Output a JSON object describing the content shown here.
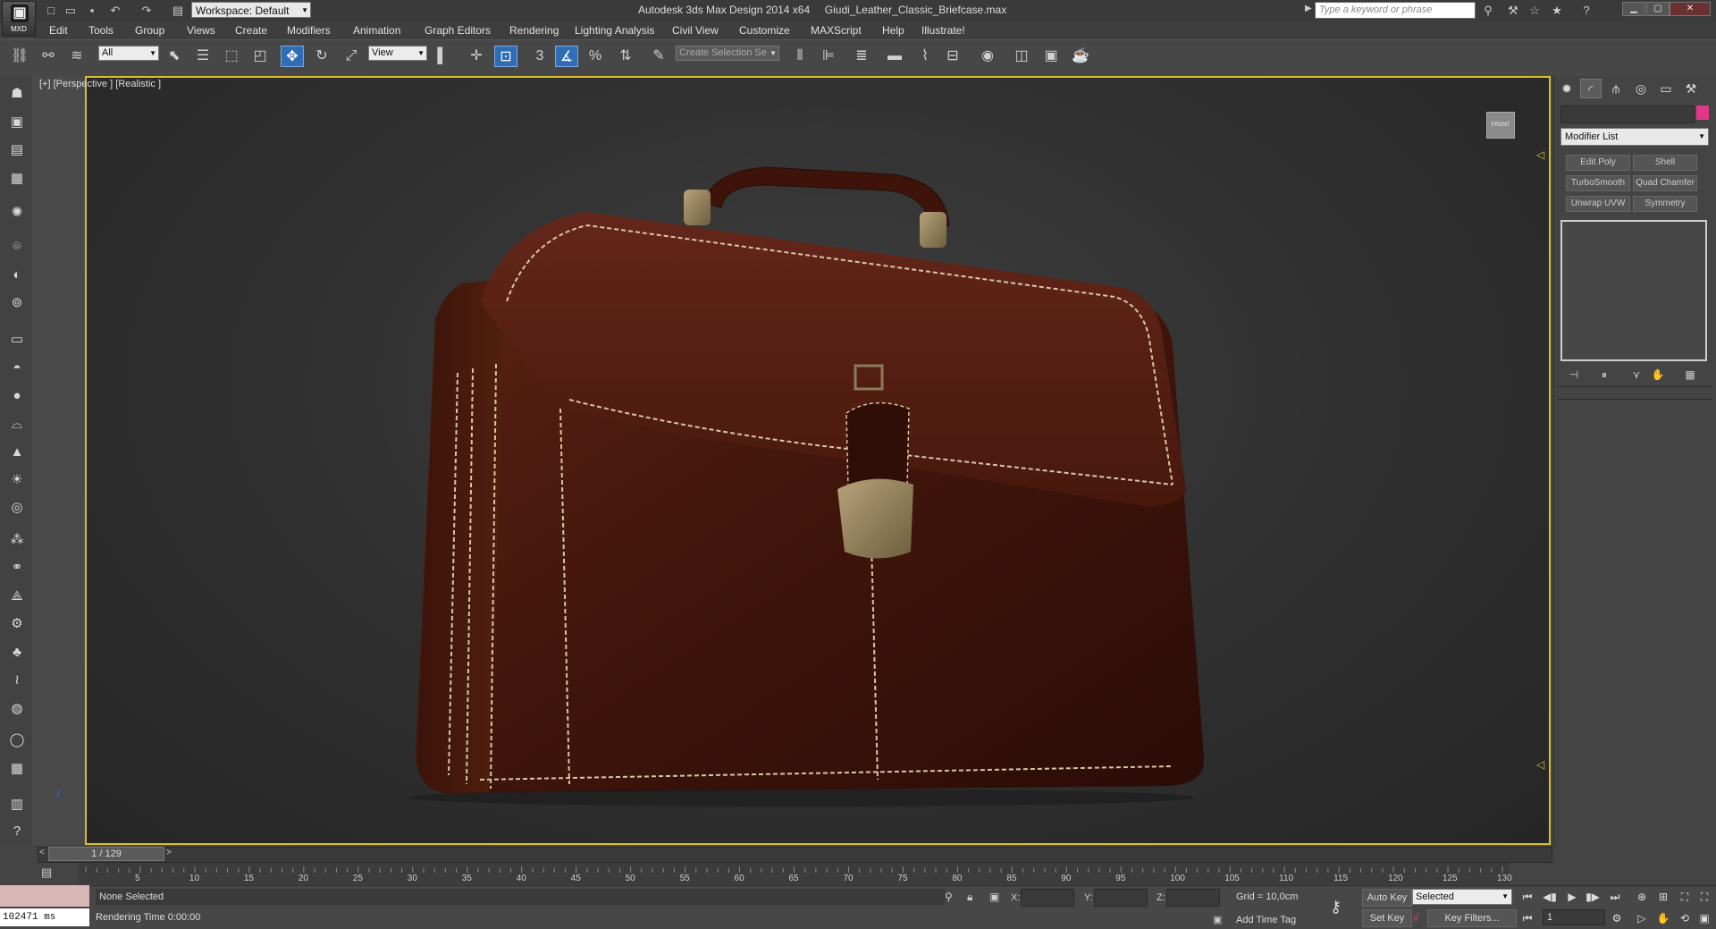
{
  "titlebar": {
    "logo_text": "MXD",
    "workspace": "Workspace: Default",
    "title": "Autodesk 3ds Max Design 2014 x64     Giudi_Leather_Classic_Briefcase.max",
    "search_placeholder": "Type a keyword or phrase",
    "quick_access_icons": [
      "new-icon",
      "open-icon",
      "save-icon",
      "undo-icon",
      "redo-icon",
      "project-icon"
    ],
    "right_icons": [
      "binoculars-icon",
      "tools-icon",
      "star-icon",
      "help-icon"
    ],
    "window_buttons": [
      "minimize",
      "restore",
      "close"
    ]
  },
  "menu": {
    "items": [
      "Edit",
      "Tools",
      "Group",
      "Views",
      "Create",
      "Modifiers",
      "Animation",
      "Graph Editors",
      "Rendering",
      "Lighting Analysis",
      "Civil View",
      "Customize",
      "MAXScript",
      "Help",
      "Illustrate!"
    ]
  },
  "toolbar": {
    "selection_filter": "All",
    "reference_coord": "View",
    "named_selection": "Create Selection Se",
    "snap_label": "3",
    "active_tool": "select-and-move"
  },
  "viewport": {
    "label": "[+] [Perspective ] [Realistic ]",
    "viewcube_label": "FRONT",
    "scene_object": "briefcase"
  },
  "timeline": {
    "current": "1 / 129",
    "prev": "<",
    "next": ">",
    "ticks": [
      "5",
      "10",
      "15",
      "20",
      "25",
      "30",
      "35",
      "40",
      "45",
      "50",
      "55",
      "60",
      "65",
      "70",
      "75",
      "80",
      "85",
      "90",
      "95",
      "100",
      "105",
      "110",
      "115",
      "120",
      "125",
      "130"
    ]
  },
  "status": {
    "maxscript_count": "102471 ms",
    "selection": "None Selected",
    "rendering_time": "Rendering Time  0:00:00",
    "x_label": "X:",
    "y_label": "Y:",
    "z_label": "Z:",
    "grid": "Grid = 10,0cm",
    "add_time_tag": "Add Time Tag",
    "auto_key": "Auto Key",
    "set_key": "Set Key",
    "key_mode": "Selected",
    "key_filters": "Key Filters...",
    "frame": "1"
  },
  "command_panel": {
    "tabs": [
      "create-icon",
      "modify-icon",
      "hierarchy-icon",
      "motion-icon",
      "display-icon",
      "utilities-icon"
    ],
    "modifier_list": "Modifier List",
    "object_color": "#e0378a",
    "modifier_buttons": [
      "Edit Poly",
      "Shell",
      "TurboSmooth",
      "Quad Chamfer",
      "Unwrap UVW",
      "Symmetry"
    ]
  },
  "colors": {
    "viewport_border": "#d8c02e",
    "active_tool": "#2f6db5",
    "leather": "#4a1a10"
  }
}
